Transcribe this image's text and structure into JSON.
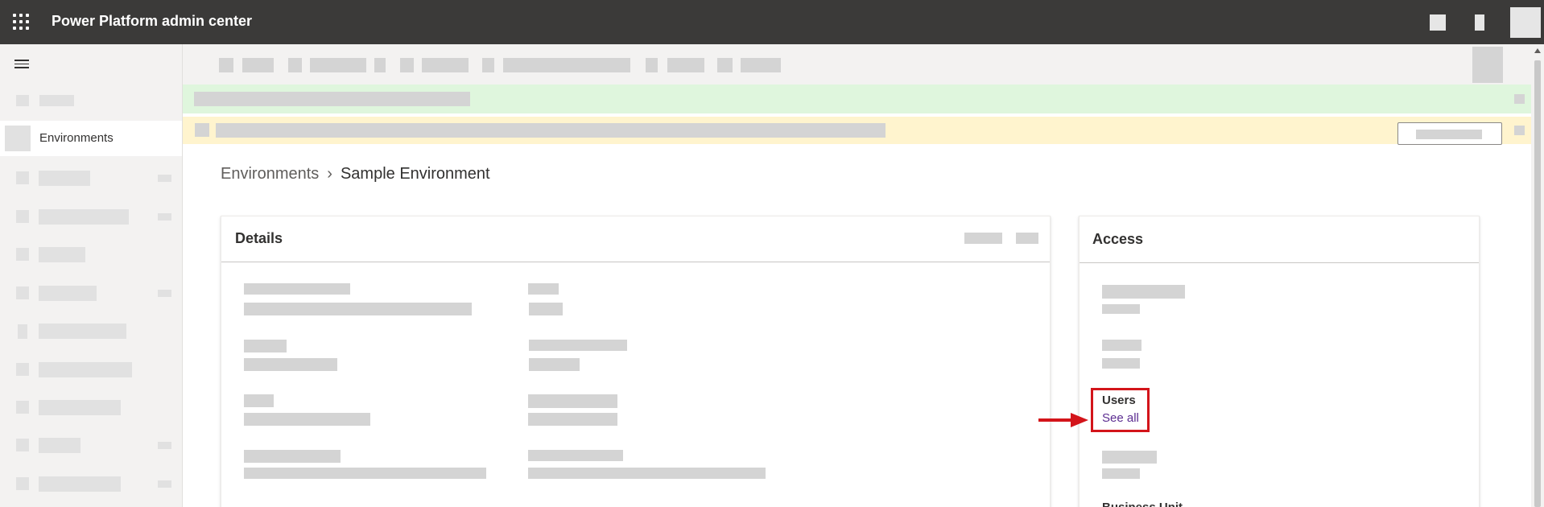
{
  "topbar": {
    "app_title": "Power Platform admin center",
    "icons": [
      "app-launcher-icon",
      "settings-icon",
      "help-icon",
      "profile-icon"
    ]
  },
  "sidebar": {
    "active_item": {
      "label": "Environments",
      "icon": "environments-icon"
    }
  },
  "breadcrumb": {
    "parent": "Environments",
    "separator": "›",
    "current": "Sample Environment"
  },
  "details_card": {
    "title": "Details"
  },
  "access_card": {
    "title": "Access",
    "users_label": "Users",
    "users_link": "See all",
    "business_unit_label": "Business Unit"
  },
  "colors": {
    "topbar": "#3b3a39",
    "sidebar": "#f3f2f1",
    "banner_success": "#dff6dd",
    "banner_warning": "#fff4ce",
    "highlight": "#d3141a",
    "link": "#5c2d91"
  }
}
